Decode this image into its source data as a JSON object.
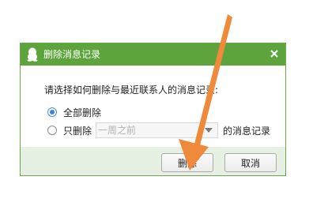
{
  "dialog": {
    "title": "删除消息记录",
    "icons": {
      "app": "qq-penguin-icon",
      "close": "close-icon"
    },
    "colors": {
      "titlebar": "#5ea43d",
      "footer": "#e6f0e3",
      "annotation_arrow": "#f08a3b"
    }
  },
  "body": {
    "prompt": "请选择如何删除与最近联系人的消息记录:",
    "options": [
      {
        "label": "全部删除",
        "checked": true
      },
      {
        "label": "只删除",
        "checked": false
      }
    ],
    "range_select": {
      "value": "一周之前"
    },
    "range_suffix": "的消息记录"
  },
  "footer": {
    "delete_label": "删除",
    "cancel_label": "取消"
  }
}
